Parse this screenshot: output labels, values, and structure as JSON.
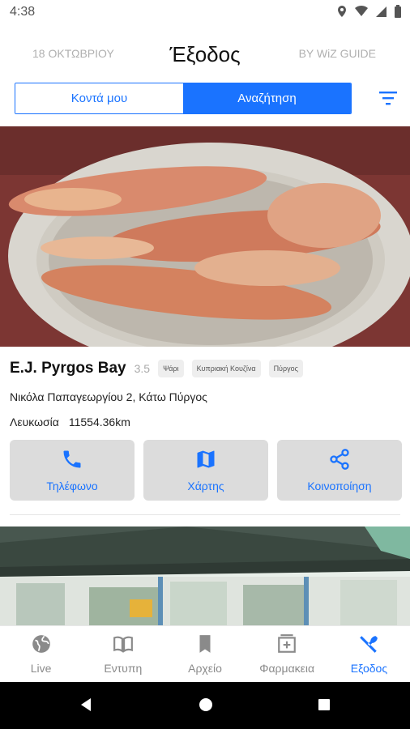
{
  "status_bar": {
    "time": "4:38"
  },
  "header": {
    "left": "18 ΟΚΤΩΒΡΙΟΥ",
    "title": "Έξοδος",
    "right": "BY WiZ GUIDE"
  },
  "tabs": [
    {
      "label": "Κοντά μου",
      "active": false
    },
    {
      "label": "Αναζήτηση",
      "active": true
    }
  ],
  "listing": {
    "name": "E.J. Pyrgos Bay",
    "rating": "3.5",
    "tags": [
      "Ψάρι",
      "Κυπριακή Κουζίνα",
      "Πύργος"
    ],
    "address": "Νικόλα Παπαγεωργίου 2, Κάτω Πύργος",
    "city": "Λευκωσία",
    "distance": "11554.36km",
    "actions": [
      {
        "label": "Τηλέφωνο",
        "icon": "phone-icon"
      },
      {
        "label": "Χάρτης",
        "icon": "map-icon"
      },
      {
        "label": "Κοινοποίηση",
        "icon": "share-icon"
      }
    ]
  },
  "bottom_nav": [
    {
      "label": "Live",
      "icon": "globe-icon",
      "active": false
    },
    {
      "label": "Εντυπη",
      "icon": "book-icon",
      "active": false
    },
    {
      "label": "Αρχείο",
      "icon": "bookmark-icon",
      "active": false
    },
    {
      "label": "Φαρμακεια",
      "icon": "pharmacy-icon",
      "active": false
    },
    {
      "label": "Εξοδος",
      "icon": "utensils-icon",
      "active": true
    }
  ],
  "colors": {
    "accent": "#1a73ff",
    "button_bg": "#dcdcdc",
    "muted": "#8a8a8a"
  }
}
